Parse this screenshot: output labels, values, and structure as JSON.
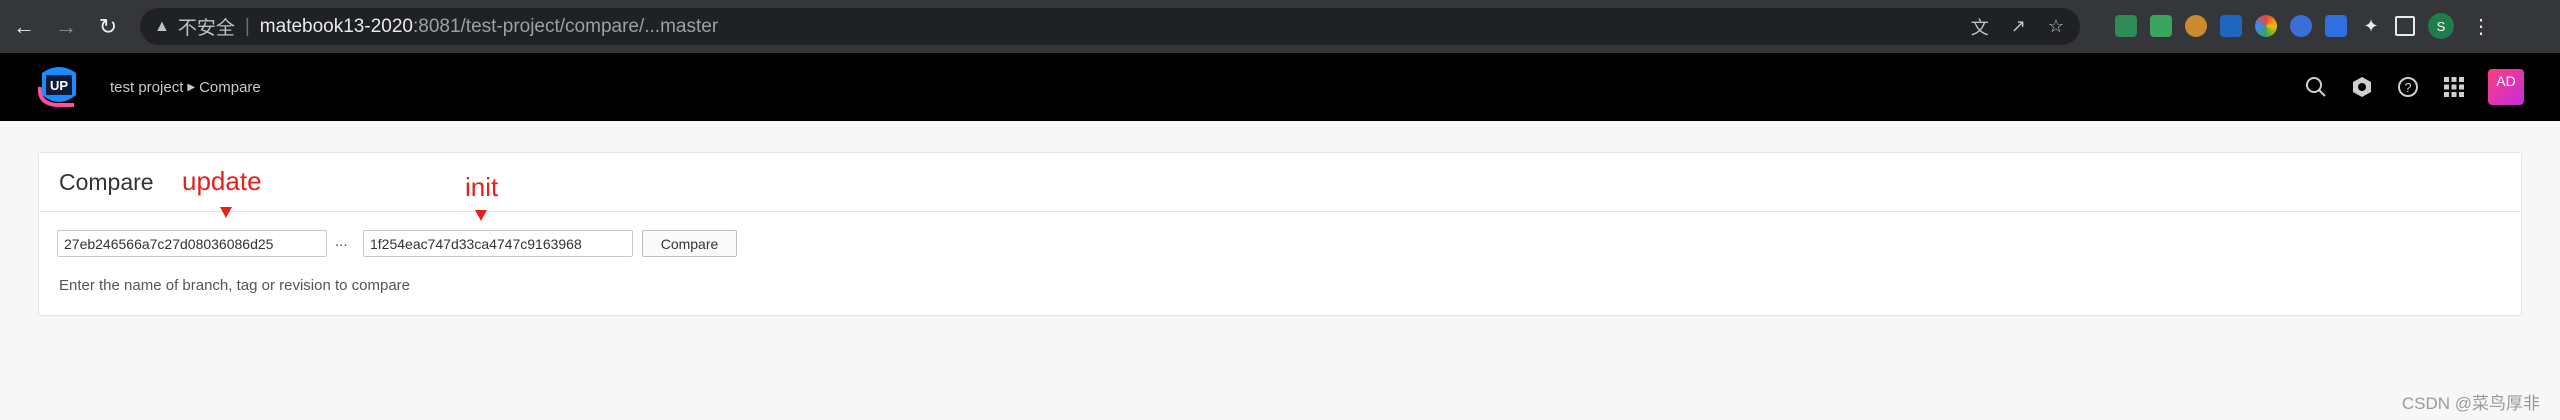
{
  "browser": {
    "insecure_label": "不安全",
    "url_host": "matebook13-2020",
    "url_rest": ":8081/test-project/compare/...master",
    "profile_initial": "S"
  },
  "app": {
    "logo_text": "UP",
    "breadcrumb": [
      "test project",
      "Compare"
    ],
    "avatar_initials": "AD",
    "accent_color": "#e4211b"
  },
  "compare": {
    "title": "Compare",
    "base_revision": "27eb246566a7c27d08036086d25",
    "target_revision": "1f254eac747d33ca4747c9163968",
    "separator": "...",
    "button_label": "Compare",
    "hint": "Enter the name of branch, tag or revision to compare"
  },
  "annotations": {
    "base_label": "update",
    "target_label": "init"
  },
  "watermark": "CSDN @菜鸟厚非"
}
